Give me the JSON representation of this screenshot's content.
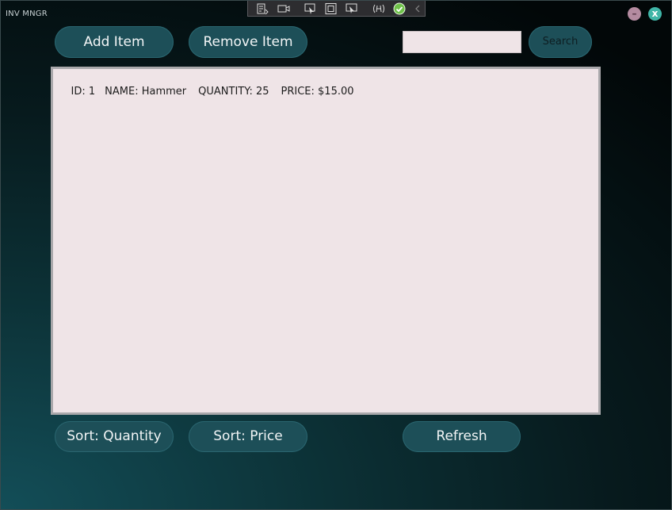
{
  "window": {
    "title": "INV MNGR",
    "minimize_label": "–",
    "close_label": "x"
  },
  "toolbar": {
    "add_label": "Add Item",
    "remove_label": "Remove Item",
    "search_label": "Search"
  },
  "search": {
    "value": "",
    "placeholder": ""
  },
  "inventory": {
    "rows": [
      {
        "id": "ID: 1",
        "name": "NAME: Hammer",
        "quantity": "QUANTITY: 25",
        "price": "PRICE: $15.00"
      }
    ]
  },
  "footer": {
    "sort_quantity_label": "Sort: Quantity",
    "sort_price_label": "Sort: Price",
    "refresh_label": "Refresh"
  },
  "debug_toolbar": {
    "icons": [
      "live-visual-tree-icon",
      "record-icon",
      "select-element-icon",
      "display-layout-adorners-icon",
      "track-focus-icon",
      "hot-reload-icon",
      "binding-ok-icon",
      "collapse-chevron-icon"
    ]
  },
  "colors": {
    "button": "#1d4f58",
    "list_bg": "#efe4e7",
    "close": "#3fb5a7",
    "minimize": "#b48ba0"
  }
}
